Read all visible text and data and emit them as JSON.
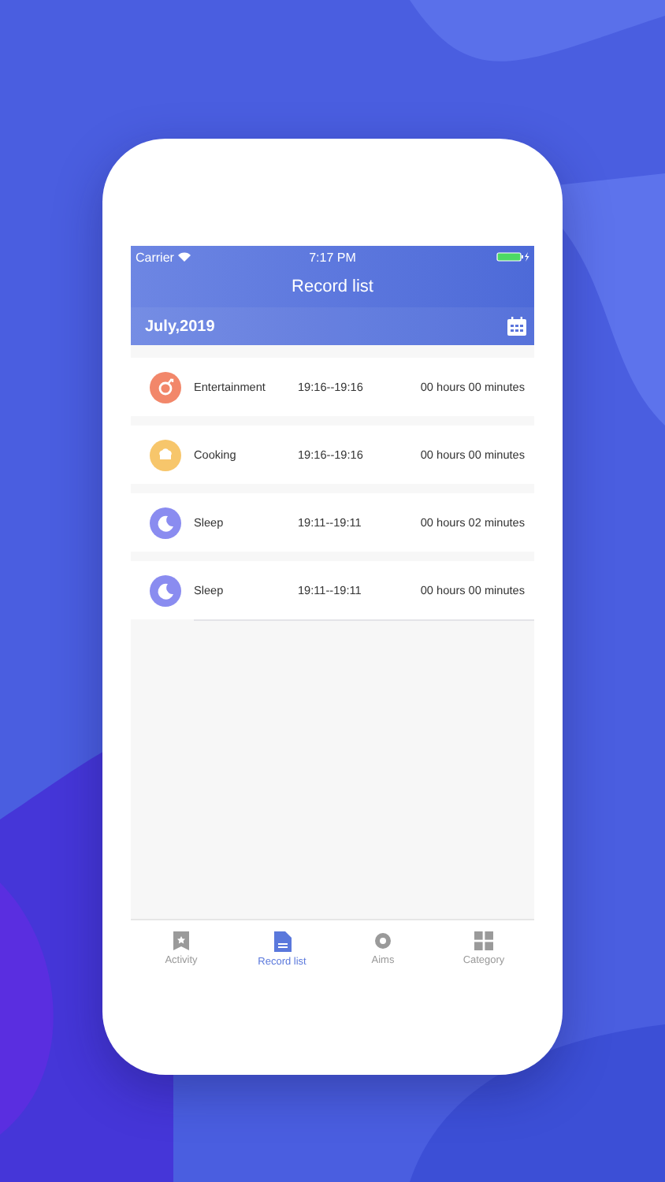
{
  "status_bar": {
    "carrier": "Carrier",
    "time": "7:17 PM"
  },
  "nav": {
    "title": "Record list"
  },
  "month_bar": {
    "month": "July,2019"
  },
  "records": [
    {
      "kind": "entertainment",
      "color": "#f2876a",
      "name": "Entertainment",
      "time_range": "19:16--19:16",
      "duration": "00 hours 00 minutes"
    },
    {
      "kind": "cooking",
      "color": "#f7c66b",
      "name": "Cooking",
      "time_range": "19:16--19:16",
      "duration": "00 hours 00 minutes"
    },
    {
      "kind": "sleep",
      "color": "#8a8cf0",
      "name": "Sleep",
      "time_range": "19:11--19:11",
      "duration": "00 hours 02 minutes"
    },
    {
      "kind": "sleep",
      "color": "#8a8cf0",
      "name": "Sleep",
      "time_range": "19:11--19:11",
      "duration": "00 hours 00 minutes"
    }
  ],
  "tabs": [
    {
      "kind": "activity",
      "label": "Activity",
      "selected": false
    },
    {
      "kind": "records",
      "label": "Record list",
      "selected": true
    },
    {
      "kind": "aims",
      "label": "Aims",
      "selected": false
    },
    {
      "kind": "category",
      "label": "Category",
      "selected": false
    }
  ]
}
